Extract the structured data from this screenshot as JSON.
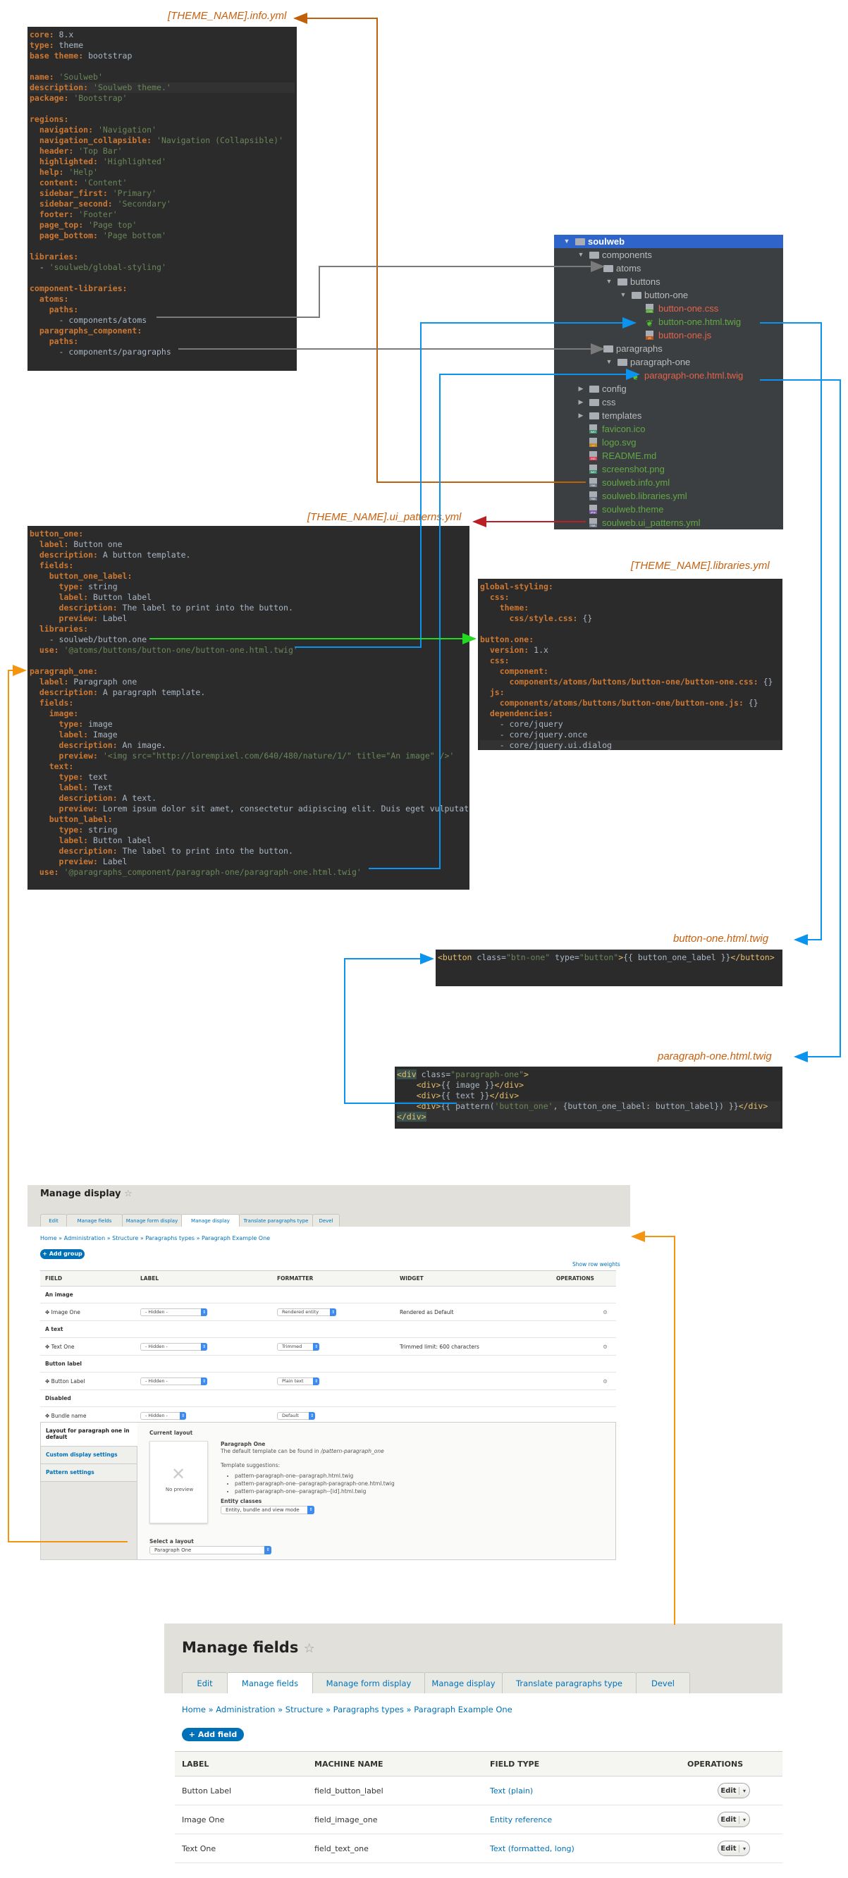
{
  "captions": {
    "info_yml": "[THEME_NAME].info.yml",
    "ui_patterns_yml": "[THEME_NAME].ui_patterns.yml",
    "libraries_yml": "[THEME_NAME].libraries.yml",
    "button_twig": "button-one.html.twig",
    "paragraph_twig": "paragraph-one.html.twig"
  },
  "info_yml": {
    "lines": [
      [
        [
          "k",
          "core:"
        ],
        [
          "v",
          " 8.x"
        ]
      ],
      [
        [
          "k",
          "type:"
        ],
        [
          "v",
          " theme"
        ]
      ],
      [
        [
          "k",
          "base theme:"
        ],
        [
          "v",
          " bootstrap"
        ]
      ],
      [],
      [
        [
          "k",
          "name:"
        ],
        [
          "s",
          " '"
        ],
        [
          "s",
          "Soulweb"
        ],
        [
          "s",
          "'"
        ]
      ],
      [
        [
          "k",
          "description:"
        ],
        [
          "s",
          " 'Soulweb theme.'"
        ]
      ],
      [
        [
          "k",
          "package:"
        ],
        [
          "s",
          " 'Bootstrap'"
        ]
      ],
      [],
      [
        [
          "k",
          "regions:"
        ]
      ],
      [
        [
          "k",
          "  navigation:"
        ],
        [
          "s",
          " 'Navigation'"
        ]
      ],
      [
        [
          "k",
          "  navigation_collapsible:"
        ],
        [
          "s",
          " 'Navigation (Collapsible)'"
        ]
      ],
      [
        [
          "k",
          "  header:"
        ],
        [
          "s",
          " 'Top Bar'"
        ]
      ],
      [
        [
          "k",
          "  highlighted:"
        ],
        [
          "s",
          " 'Highlighted'"
        ]
      ],
      [
        [
          "k",
          "  help:"
        ],
        [
          "s",
          " 'Help'"
        ]
      ],
      [
        [
          "k",
          "  content:"
        ],
        [
          "s",
          " 'Content'"
        ]
      ],
      [
        [
          "k",
          "  sidebar_first:"
        ],
        [
          "s",
          " 'Primary'"
        ]
      ],
      [
        [
          "k",
          "  sidebar_second:"
        ],
        [
          "s",
          " 'Secondary'"
        ]
      ],
      [
        [
          "k",
          "  footer:"
        ],
        [
          "s",
          " 'Footer'"
        ]
      ],
      [
        [
          "k",
          "  page_top:"
        ],
        [
          "s",
          " 'Page top'"
        ]
      ],
      [
        [
          "k",
          "  page_bottom:"
        ],
        [
          "s",
          " 'Page bottom'"
        ]
      ],
      [],
      [
        [
          "k",
          "libraries:"
        ]
      ],
      [
        [
          "v",
          "  - "
        ],
        [
          "s",
          "'soulweb/global-styling'"
        ]
      ],
      [],
      [
        [
          "k",
          "component-libraries:"
        ]
      ],
      [
        [
          "k",
          "  atoms:"
        ]
      ],
      [
        [
          "k",
          "    paths:"
        ]
      ],
      [
        [
          "v",
          "      - components/atoms"
        ]
      ],
      [
        [
          "k",
          "  paragraphs_component:"
        ]
      ],
      [
        [
          "k",
          "    paths:"
        ]
      ],
      [
        [
          "v",
          "      - components/paragraphs"
        ]
      ]
    ]
  },
  "file_tree": [
    {
      "label": "soulweb",
      "type": "folder",
      "depth": 0,
      "expanded": true,
      "selected": true,
      "color": "white"
    },
    {
      "label": "components",
      "type": "folder",
      "depth": 1,
      "expanded": true,
      "color": "default"
    },
    {
      "label": "atoms",
      "type": "folder",
      "depth": 2,
      "expanded": true,
      "color": "default"
    },
    {
      "label": "buttons",
      "type": "folder",
      "depth": 3,
      "expanded": true,
      "color": "default"
    },
    {
      "label": "button-one",
      "type": "folder",
      "depth": 4,
      "expanded": true,
      "color": "default"
    },
    {
      "label": "button-one.css",
      "type": "file",
      "badge": "CSS",
      "badge_color": "#4c9a2a",
      "depth": 5,
      "color": "red"
    },
    {
      "label": "button-one.html.twig",
      "type": "twig",
      "depth": 5,
      "color": "green"
    },
    {
      "label": "button-one.js",
      "type": "file",
      "badge": "JS",
      "badge_color": "#c2571a",
      "depth": 5,
      "color": "red"
    },
    {
      "label": "paragraphs",
      "type": "folder",
      "depth": 2,
      "expanded": true,
      "color": "default"
    },
    {
      "label": "paragraph-one",
      "type": "folder",
      "depth": 3,
      "expanded": true,
      "color": "default"
    },
    {
      "label": "paragraph-one.html.twig",
      "type": "twig",
      "depth": 4,
      "color": "red"
    },
    {
      "label": "config",
      "type": "folder",
      "depth": 1,
      "expanded": false,
      "color": "default"
    },
    {
      "label": "css",
      "type": "folder",
      "depth": 1,
      "expanded": false,
      "color": "default"
    },
    {
      "label": "templates",
      "type": "folder",
      "depth": 1,
      "expanded": false,
      "color": "default"
    },
    {
      "label": "favicon.ico",
      "type": "file",
      "badge": "IMG",
      "badge_color": "#3f8f6f",
      "depth": 1,
      "color": "green"
    },
    {
      "label": "logo.svg",
      "type": "file",
      "badge": "<>",
      "badge_color": "#c58b22",
      "depth": 1,
      "color": "green"
    },
    {
      "label": "README.md",
      "type": "file",
      "badge": "MD",
      "badge_color": "#d9435a",
      "depth": 1,
      "color": "green"
    },
    {
      "label": "screenshot.png",
      "type": "file",
      "badge": "IMG",
      "badge_color": "#3f8f6f",
      "depth": 1,
      "color": "green"
    },
    {
      "label": "soulweb.info.yml",
      "type": "file",
      "badge": "YML",
      "badge_color": "#6c7883",
      "depth": 1,
      "color": "green"
    },
    {
      "label": "soulweb.libraries.yml",
      "type": "file",
      "badge": "YML",
      "badge_color": "#6c7883",
      "depth": 1,
      "color": "green"
    },
    {
      "label": "soulweb.theme",
      "type": "file",
      "badge": "php",
      "badge_color": "#7a5ba8",
      "depth": 1,
      "color": "green"
    },
    {
      "label": "soulweb.ui_patterns.yml",
      "type": "file",
      "badge": "YML",
      "badge_color": "#6c7883",
      "depth": 1,
      "color": "green"
    }
  ],
  "ui_patterns_yml": {
    "lines": [
      [
        [
          "k",
          "button_one:"
        ]
      ],
      [
        [
          "k",
          "  label:"
        ],
        [
          "v",
          " Button one"
        ]
      ],
      [
        [
          "k",
          "  description:"
        ],
        [
          "v",
          " A button template."
        ]
      ],
      [
        [
          "k",
          "  fields:"
        ]
      ],
      [
        [
          "k",
          "    button_one_label:"
        ]
      ],
      [
        [
          "k",
          "      type:"
        ],
        [
          "v",
          " string"
        ]
      ],
      [
        [
          "k",
          "      label:"
        ],
        [
          "v",
          " Button label"
        ]
      ],
      [
        [
          "k",
          "      description:"
        ],
        [
          "v",
          " The label to print into the button."
        ]
      ],
      [
        [
          "k",
          "      preview:"
        ],
        [
          "v",
          " Label"
        ]
      ],
      [
        [
          "k",
          "  libraries:"
        ]
      ],
      [
        [
          "v",
          "    - soulweb/button.one"
        ]
      ],
      [
        [
          "k",
          "  use:"
        ],
        [
          "s",
          " '@atoms/buttons/button-one/button-one.html.twig'"
        ]
      ],
      [],
      [
        [
          "k",
          "paragraph_one:"
        ]
      ],
      [
        [
          "k",
          "  label:"
        ],
        [
          "v",
          " Paragraph one"
        ]
      ],
      [
        [
          "k",
          "  description:"
        ],
        [
          "v",
          " A paragraph template."
        ]
      ],
      [
        [
          "k",
          "  fields:"
        ]
      ],
      [
        [
          "k",
          "    image:"
        ]
      ],
      [
        [
          "k",
          "      type:"
        ],
        [
          "v",
          " image"
        ]
      ],
      [
        [
          "k",
          "      label:"
        ],
        [
          "v",
          " Image"
        ]
      ],
      [
        [
          "k",
          "      description:"
        ],
        [
          "v",
          " An image."
        ]
      ],
      [
        [
          "k",
          "      preview:"
        ],
        [
          "s",
          " '<img src=\"http://lorempixel.com/640/480/nature/1/\" title=\"An image\" />'"
        ]
      ],
      [
        [
          "k",
          "    text:"
        ]
      ],
      [
        [
          "k",
          "      type:"
        ],
        [
          "v",
          " text"
        ]
      ],
      [
        [
          "k",
          "      label:"
        ],
        [
          "v",
          " Text"
        ]
      ],
      [
        [
          "k",
          "      description:"
        ],
        [
          "v",
          " A text."
        ]
      ],
      [
        [
          "k",
          "      preview:"
        ],
        [
          "v",
          " Lorem ipsum dolor sit amet, consectetur adipiscing elit. Duis eget vulputat"
        ]
      ],
      [
        [
          "k",
          "    button_label:"
        ]
      ],
      [
        [
          "k",
          "      type:"
        ],
        [
          "v",
          " string"
        ]
      ],
      [
        [
          "k",
          "      label:"
        ],
        [
          "v",
          " Button label"
        ]
      ],
      [
        [
          "k",
          "      description:"
        ],
        [
          "v",
          " The label to print into the button."
        ]
      ],
      [
        [
          "k",
          "      preview:"
        ],
        [
          "v",
          " Label"
        ]
      ],
      [
        [
          "k",
          "  use:"
        ],
        [
          "s",
          " '@paragraphs_component/paragraph-one/paragraph-one.html.twig'"
        ]
      ]
    ]
  },
  "libraries_yml": {
    "lines": [
      [
        [
          "k",
          "global-styling:"
        ]
      ],
      [
        [
          "k",
          "  css:"
        ]
      ],
      [
        [
          "k",
          "    theme:"
        ]
      ],
      [
        [
          "k",
          "      css/style.css:"
        ],
        [
          "v",
          " {}"
        ]
      ],
      [],
      [
        [
          "k",
          "button.one:"
        ]
      ],
      [
        [
          "k",
          "  version:"
        ],
        [
          "v",
          " 1.x"
        ]
      ],
      [
        [
          "k",
          "  css:"
        ]
      ],
      [
        [
          "k",
          "    component:"
        ]
      ],
      [
        [
          "k",
          "      components/atoms/buttons/button-one/button-one.css:"
        ],
        [
          "v",
          " {}"
        ]
      ],
      [
        [
          "k",
          "  js:"
        ]
      ],
      [
        [
          "k",
          "    components/atoms/buttons/button-one/button-one.js:"
        ],
        [
          "v",
          " {}"
        ]
      ],
      [
        [
          "k",
          "  dependencies:"
        ]
      ],
      [
        [
          "v",
          "    - core/jquery"
        ]
      ],
      [
        [
          "v",
          "    - core/jquery.once"
        ]
      ],
      [
        [
          "v",
          "    - core/jquery.ui.dialog"
        ]
      ]
    ]
  },
  "button_twig": {
    "lines": [
      [
        [
          "t",
          "<button"
        ],
        [
          "v",
          " class="
        ],
        [
          "s",
          "\"btn-one\""
        ],
        [
          "v",
          " type="
        ],
        [
          "s",
          "\"button\""
        ],
        [
          "t",
          ">"
        ],
        [
          "v",
          "{{ button_one_label }}"
        ],
        [
          "t",
          "</button>"
        ]
      ]
    ]
  },
  "paragraph_twig": {
    "lines": [
      [
        [
          "tg",
          "<div"
        ],
        [
          "v",
          " class="
        ],
        [
          "s",
          "\"paragraph-one\""
        ],
        [
          "t",
          ">"
        ]
      ],
      [
        [
          "v",
          "    "
        ],
        [
          "t",
          "<div>"
        ],
        [
          "v",
          "{{ image }}"
        ],
        [
          "t",
          "</div>"
        ]
      ],
      [
        [
          "v",
          "    "
        ],
        [
          "t",
          "<div>"
        ],
        [
          "v",
          "{{ text }}"
        ],
        [
          "t",
          "</div>"
        ]
      ],
      [
        [
          "v",
          "    "
        ],
        [
          "t",
          "<div>"
        ],
        [
          "v",
          "{{ pattern("
        ],
        [
          "s",
          "'button_one'"
        ],
        [
          "v",
          ", {button_one_label: button_label}) }}"
        ],
        [
          "t",
          "</div>"
        ]
      ],
      [
        [
          "tg",
          "</div>"
        ]
      ]
    ]
  },
  "manage_display": {
    "title": "Manage display",
    "star_icon": "☆",
    "tabs": [
      "Edit",
      "Manage fields",
      "Manage form display",
      "Manage display",
      "Translate paragraphs type",
      "Devel"
    ],
    "active_tab": 3,
    "breadcrumb": "Home » Administration » Structure » Paragraphs types » Paragraph Example One",
    "add_group_label": "+ Add group",
    "show_row_weights": "Show row weights",
    "columns": [
      "FIELD",
      "LABEL",
      "FORMATTER",
      "WIDGET",
      "OPERATIONS"
    ],
    "rows": [
      {
        "kind": "group",
        "label": "An image"
      },
      {
        "kind": "field",
        "field": "Image One",
        "label": "- Hidden -",
        "formatter": "Rendered entity",
        "widget": "Rendered as Default",
        "gear": true
      },
      {
        "kind": "group",
        "label": "A text"
      },
      {
        "kind": "field",
        "field": "Text One",
        "label": "- Hidden -",
        "formatter": "Trimmed",
        "widget": "Trimmed limit: 600 characters",
        "gear": true
      },
      {
        "kind": "group",
        "label": "Button label"
      },
      {
        "kind": "field",
        "field": "Button Label",
        "label": "- Hidden -",
        "formatter": "Plain text",
        "widget": "",
        "gear": true
      },
      {
        "kind": "group",
        "label": "Disabled"
      },
      {
        "kind": "field",
        "field": "Bundle name",
        "label": "- Hidden -",
        "formatter": "Default",
        "widget": "",
        "gear": false
      }
    ],
    "layout_panel": {
      "vtabs": [
        "Layout for paragraph one in default",
        "Custom display settings",
        "Pattern settings"
      ],
      "current_layout_label": "Current layout",
      "no_preview": "No preview",
      "pattern_name": "Paragraph One",
      "default_template_text": "The default template can be found in",
      "default_template_path": "/pattern-paragraph_one",
      "template_suggestions_label": "Template suggestions:",
      "template_suggestions": [
        "pattern-paragraph-one--paragraph.html.twig",
        "pattern-paragraph-one--paragraph-paragraph-one.html.twig",
        "pattern-paragraph-one--paragraph--[id].html.twig"
      ],
      "entity_classes_label": "Entity classes",
      "entity_classes_value": "Entity, bundle and view mode",
      "select_layout_label": "Select a layout",
      "select_layout_value": "Paragraph One"
    }
  },
  "manage_fields": {
    "title": "Manage fields",
    "star_icon": "☆",
    "tabs": [
      "Edit",
      "Manage fields",
      "Manage form display",
      "Manage display",
      "Translate paragraphs type",
      "Devel"
    ],
    "active_tab": 1,
    "breadcrumb": "Home » Administration » Structure » Paragraphs types » Paragraph Example One",
    "add_field_label": "+ Add field",
    "columns": [
      "LABEL",
      "MACHINE NAME",
      "FIELD TYPE",
      "OPERATIONS"
    ],
    "rows": [
      {
        "label": "Button Label",
        "machine_name": "field_button_label",
        "field_type": "Text (plain)",
        "op": "Edit"
      },
      {
        "label": "Image One",
        "machine_name": "field_image_one",
        "field_type": "Entity reference",
        "op": "Edit"
      },
      {
        "label": "Text One",
        "machine_name": "field_text_one",
        "field_type": "Text (formatted, long)",
        "op": "Edit"
      }
    ]
  },
  "connector_colors": {
    "info": "#c0600a",
    "ui_patterns": "#b82025",
    "components": "#7a7a7a",
    "twig": "#0a94f0",
    "library": "#22d822",
    "layout": "#f5950f"
  }
}
